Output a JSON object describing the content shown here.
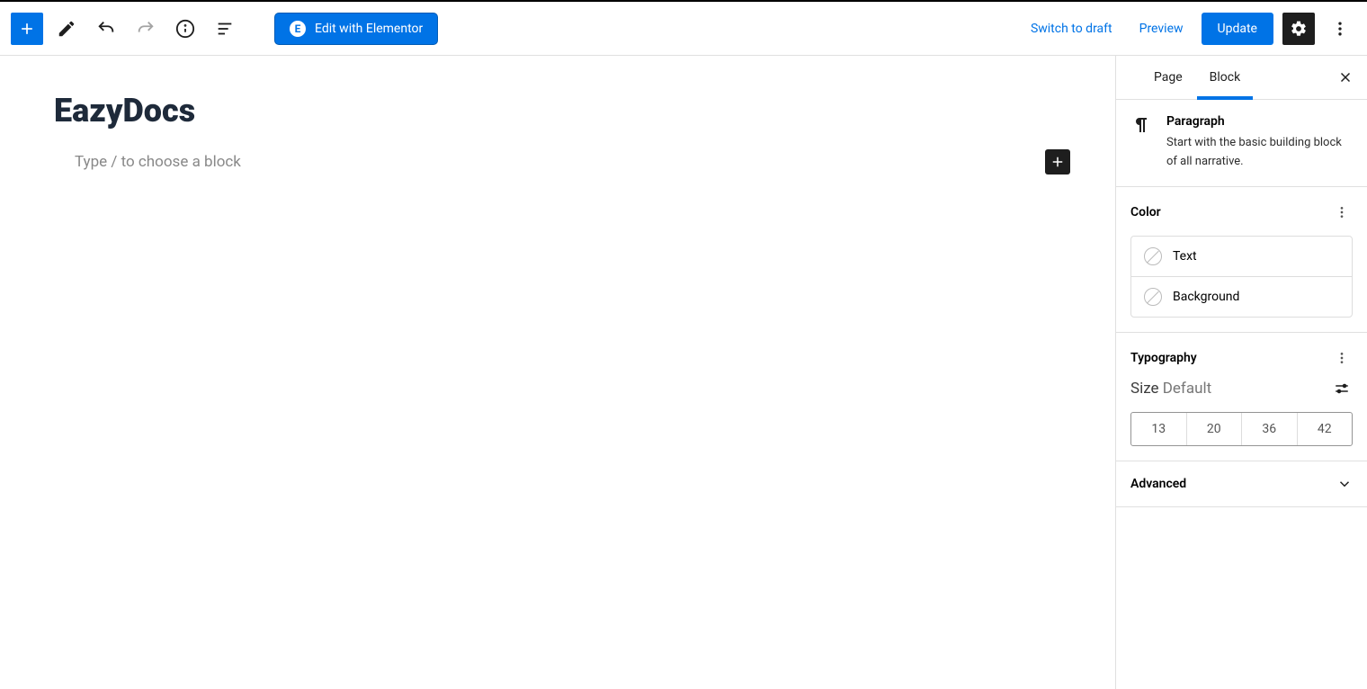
{
  "toolbar": {
    "elementor_label": "Edit with Elementor",
    "switch_draft": "Switch to draft",
    "preview": "Preview",
    "update": "Update"
  },
  "editor": {
    "title": "EazyDocs",
    "placeholder": "Type / to choose a block"
  },
  "sidebar": {
    "tabs": {
      "page": "Page",
      "block": "Block"
    },
    "block_type": {
      "name": "Paragraph",
      "description": "Start with the basic building block of all narrative."
    },
    "color": {
      "heading": "Color",
      "text": "Text",
      "background": "Background"
    },
    "typography": {
      "heading": "Typography",
      "size_label": "Size",
      "size_value": "Default",
      "sizes": [
        "13",
        "20",
        "36",
        "42"
      ]
    },
    "advanced": "Advanced"
  }
}
